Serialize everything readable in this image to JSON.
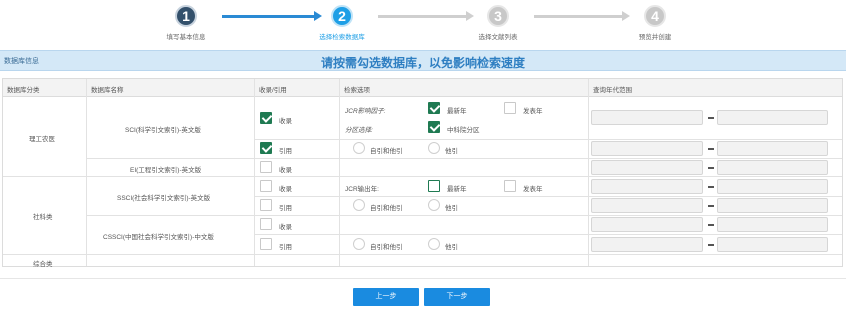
{
  "steps": [
    {
      "num": "1",
      "label": "填写基本信息"
    },
    {
      "num": "2",
      "label": "选择检索数据库"
    },
    {
      "num": "3",
      "label": "选择文献列表"
    },
    {
      "num": "4",
      "label": "预览并创建"
    }
  ],
  "bar": {
    "left": "数据库信息",
    "center": "请按需勾选数据库，以免影响检索速度"
  },
  "headers": {
    "category": "数据库分类",
    "name": "数据库名称",
    "collect": "收录/引用",
    "options": "检索选项",
    "range": "查询年代范围"
  },
  "categories": {
    "sci_eng": "理工农医",
    "social": "社科类",
    "general": "综合类"
  },
  "databases": {
    "sci": "SCI(科学引文索引)-英文版",
    "ei": "EI(工程引文索引)-英文版",
    "ssci": "SSCI(社会科学引文索引)-英文版",
    "cssci": "CSSCI(中国社会科学引文索引)-中文版"
  },
  "labels": {
    "collect": "收录",
    "cite": "引用",
    "jcr_if": "JCR影响因子:",
    "partition": "分区选择:",
    "latest_year": "最新年",
    "publish_year": "发表年",
    "cas_partition": "中科院分区",
    "self_and_other": "自引和他引",
    "other": "他引",
    "jcr_pub": "JCR输出年:",
    "range_dash": "-"
  },
  "state": {
    "sci_collect": true,
    "sci_cite": true,
    "jcr_latest": true,
    "jcr_publish": false,
    "cas_partition": true
  },
  "buttons": {
    "prev": "上一步",
    "next": "下一步"
  }
}
